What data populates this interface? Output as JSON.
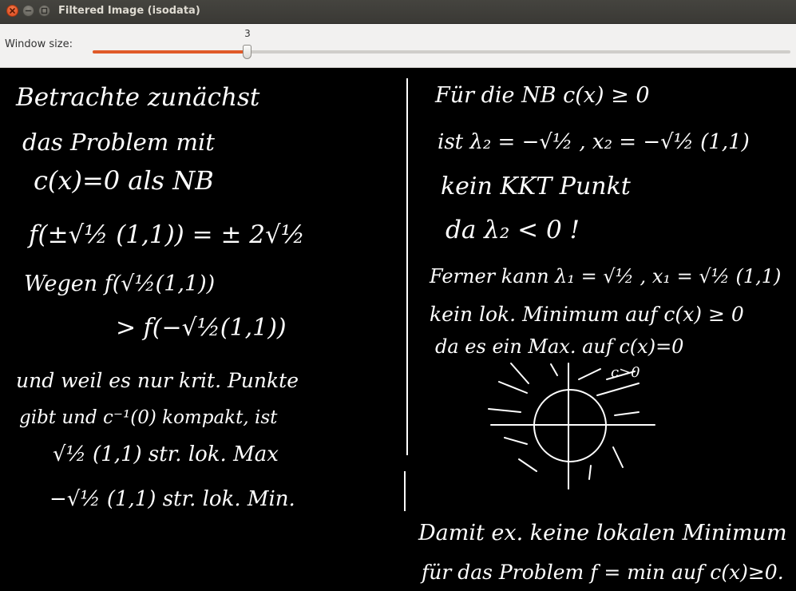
{
  "window": {
    "title": "Filtered Image (isodata)",
    "controls": [
      "close",
      "minimize",
      "maximize"
    ]
  },
  "toolbar": {
    "label": "Window size:",
    "slider": {
      "value": 3,
      "value_label": "3",
      "min": 1,
      "max": 10,
      "fill_color": "#e05a28"
    }
  },
  "image": {
    "background": "#000000",
    "ink": "#ffffff",
    "left_column": [
      "Betrachte zunächst",
      "das Problem mit",
      "c(x)=0 als NB",
      "f(±√½ (1,1)) = ± 2√½",
      "Wegen f(√½(1,1))",
      "> f(−√½(1,1))",
      "und weil es nur krit. Punkte",
      "gibt und c⁻¹(0) kompakt, ist",
      "√½ (1,1) str. lok. Max",
      "−√½ (1,1) str. lok. Min."
    ],
    "right_column": [
      "Für die NB c(x) ≥ 0",
      "ist λ₂ = −√½ , x₂ = −√½ (1,1)",
      "kein KKT Punkt",
      "da λ₂ < 0 !",
      "Ferner kann λ₁ = √½ , x₁ = √½ (1,1)",
      "kein lok. Minimum auf c(x) ≥ 0",
      "da es ein Max. auf c(x)=0",
      "c>0",
      "Damit ex. keine lokalen Minimum",
      "für das Problem f = min auf c(x)≥0."
    ]
  }
}
